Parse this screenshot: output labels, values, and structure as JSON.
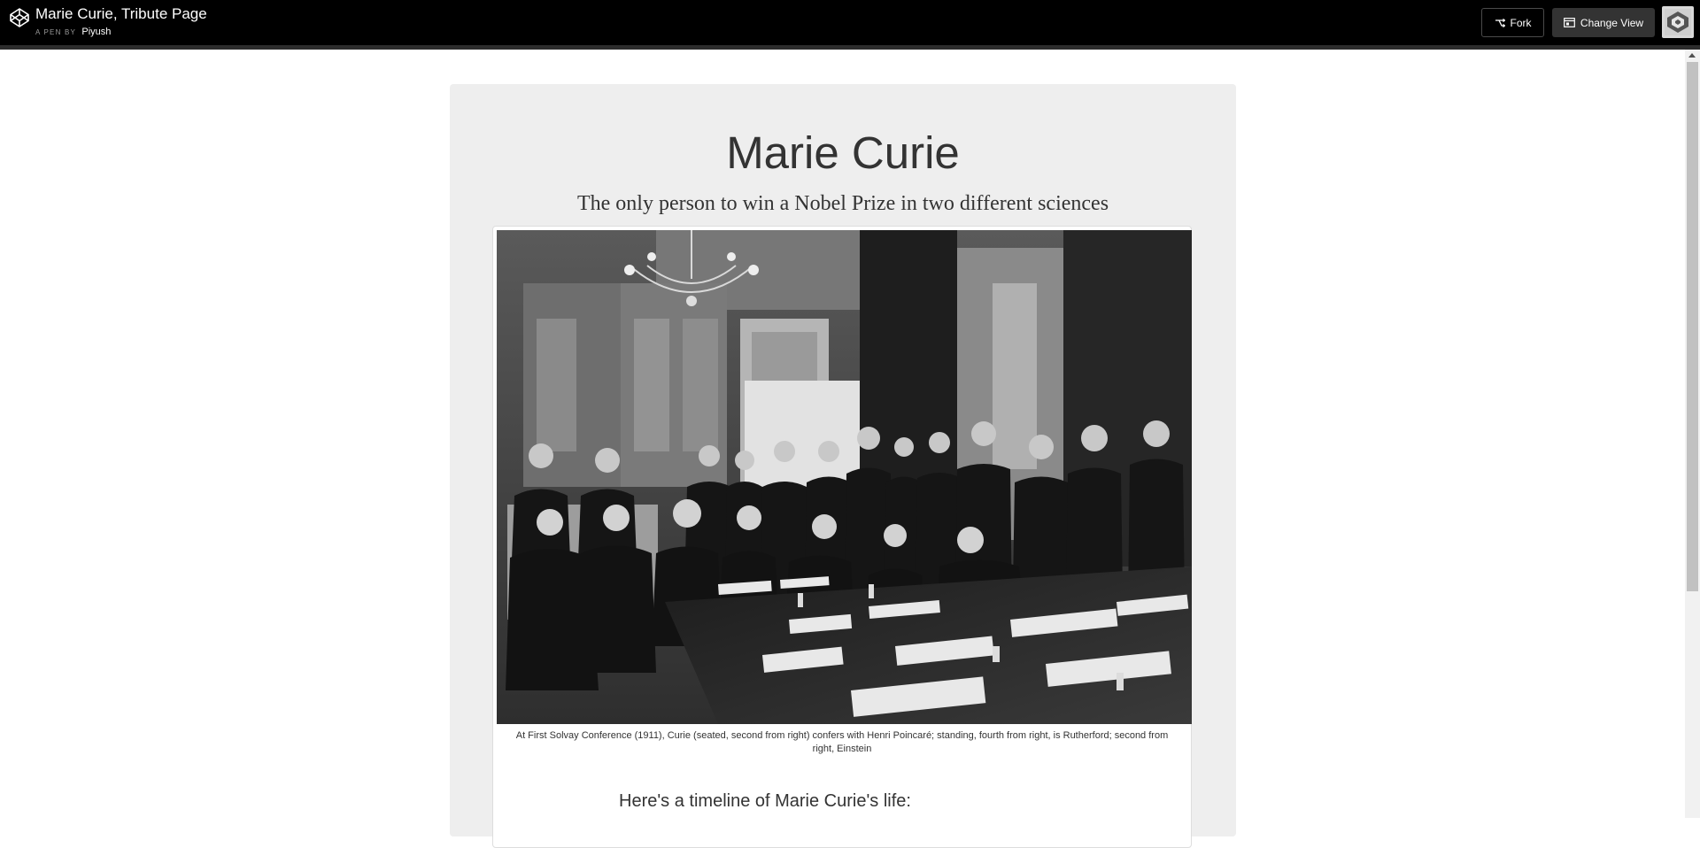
{
  "header": {
    "pen_title": "Marie Curie, Tribute Page",
    "pen_by_label": "A PEN BY",
    "author": "Piyush",
    "fork_label": "Fork",
    "change_view_label": "Change View",
    "icons": {
      "logo": "codepen-logo-icon",
      "fork": "fork-icon",
      "change_view": "change-view-icon",
      "avatar": "user-avatar"
    }
  },
  "tribute": {
    "title": "Marie Curie",
    "subtitle": "The only person to win a Nobel Prize in two different sciences",
    "image_caption": "At First Solvay Conference (1911), Curie (seated, second from right) confers with Henri Poincaré; standing, fourth from right, is Rutherford; second from right, Einstein",
    "timeline_heading": "Here's a timeline of Marie Curie's life:"
  },
  "colors": {
    "topbar_bg": "#000000",
    "main_bg": "#eeeeee",
    "text": "#333333"
  }
}
